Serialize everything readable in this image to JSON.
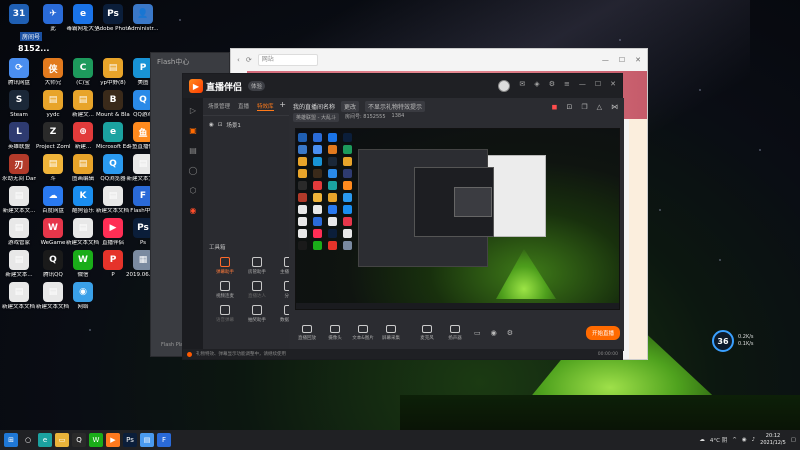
{
  "desktop": {
    "icons": [
      {
        "label": "",
        "glyph": "31",
        "color": "#1f5fb3"
      },
      {
        "label": "此",
        "glyph": "✈",
        "color": "#2a6bd8"
      },
      {
        "label": "毒霸网址大全",
        "glyph": "e",
        "color": "#1a73e8"
      },
      {
        "label": "Adobe Photosh...",
        "glyph": "Ps",
        "color": "#0b1e3a"
      },
      {
        "label": "Administr...",
        "glyph": "👤",
        "color": "#3a78c8"
      },
      {
        "label": "腾讯网盘",
        "glyph": "⟳",
        "color": "#4a8ef0"
      },
      {
        "label": "大师兄",
        "glyph": "侠",
        "color": "#e27a1e"
      },
      {
        "label": "(C)宝",
        "glyph": "C",
        "color": "#1d9a5c"
      },
      {
        "label": "yp中野(8)",
        "glyph": "▤",
        "color": "#e8a42a"
      },
      {
        "label": "美图",
        "glyph": "P",
        "color": "#1893d6"
      },
      {
        "label": "Steam",
        "glyph": "S",
        "color": "#1b2838"
      },
      {
        "label": "yydc",
        "glyph": "▤",
        "color": "#e8a42a"
      },
      {
        "label": "新建文...",
        "glyph": "▤",
        "color": "#e8a42a"
      },
      {
        "label": "Mount & Blade II...",
        "glyph": "B",
        "color": "#3a2a1a"
      },
      {
        "label": "QQ游戏",
        "glyph": "Q",
        "color": "#2a8ae8"
      },
      {
        "label": "英雄联盟",
        "glyph": "L",
        "color": "#2e3b70"
      },
      {
        "label": "Project Zomboid",
        "glyph": "Z",
        "color": "#2a2a2a"
      },
      {
        "label": "新建...",
        "glyph": "⊕",
        "color": "#e23b3b"
      },
      {
        "label": "Microsoft Edge",
        "glyph": "e",
        "color": "#1ba2a0"
      },
      {
        "label": "斗鱼直播伴侣",
        "glyph": "鱼",
        "color": "#ff8a1e"
      },
      {
        "label": "永劫无间 Dance of Fir...",
        "glyph": "刃",
        "color": "#b23a2a"
      },
      {
        "label": "斗",
        "glyph": "▤",
        "color": "#f0b43a"
      },
      {
        "label": "图画编辑",
        "glyph": "▤",
        "color": "#e8a42a"
      },
      {
        "label": "QQ浏览器",
        "glyph": "Q",
        "color": "#2a9af0"
      },
      {
        "label": "新建文本文档",
        "glyph": "▤",
        "color": "#e8e8e8"
      },
      {
        "label": "新建文本文...",
        "glyph": "▤",
        "color": "#e8e8e8"
      },
      {
        "label": "百度网盘",
        "glyph": "☁",
        "color": "#2a7af0"
      },
      {
        "label": "酷狗音乐",
        "glyph": "K",
        "color": "#1a8ef0"
      },
      {
        "label": "新建文本文档 (2)",
        "glyph": "▤",
        "color": "#e8e8e8"
      },
      {
        "label": "Flash中心",
        "glyph": "F",
        "color": "#2a6ad8"
      },
      {
        "label": "游戏管家",
        "glyph": "▤",
        "color": "#e8e8e8"
      },
      {
        "label": "WeGame",
        "glyph": "W",
        "color": "#e6364a"
      },
      {
        "label": "新建文本文档 (3)",
        "glyph": "▤",
        "color": "#e8e8e8"
      },
      {
        "label": "直播伴侣",
        "glyph": "▶",
        "color": "#ff2e55"
      },
      {
        "label": "Ps",
        "glyph": "Ps",
        "color": "#0b1e3a"
      },
      {
        "label": "新建文本...",
        "glyph": "▤",
        "color": "#e8e8e8"
      },
      {
        "label": "腾讯QQ",
        "glyph": "Q",
        "color": "#1a1a1a"
      },
      {
        "label": "微信",
        "glyph": "W",
        "color": "#1aad19"
      },
      {
        "label": "P",
        "glyph": "P",
        "color": "#e5332a"
      },
      {
        "label": "2019.06.11 截图",
        "glyph": "▦",
        "color": "#7a8aa0"
      },
      {
        "label": "新建文本文档 (4)",
        "glyph": "▤",
        "color": "#e8e8e8"
      },
      {
        "label": "新建文本文档 (7)",
        "glyph": "▤",
        "color": "#e8e8e8"
      },
      {
        "label": "网络",
        "glyph": "◉",
        "color": "#3aa0e8"
      }
    ],
    "room_label": "房间号",
    "room_number": "8152...",
    "rates": [
      "0.2K/s",
      "0.1K/s"
    ],
    "widget_value": "36"
  },
  "ghost_window": {
    "title": "Flash中心",
    "footer": "Flash Play..."
  },
  "browser": {
    "address": "网站"
  },
  "live": {
    "app_title": "直播伴侣",
    "badge": "体验",
    "left_tabs": [
      "场景管理",
      "直播",
      "特效库"
    ],
    "active_tab_index": 2,
    "scene_label": "场景1",
    "toolbox_title": "工具箱",
    "tools": [
      {
        "label": "弹幕助手",
        "hot": true
      },
      {
        "label": "房管助手",
        "hot": false
      },
      {
        "label": "主播任务",
        "hot": false
      },
      {
        "label": "视频连麦",
        "hot": false
      },
      {
        "label": "直播达人",
        "hot": false,
        "dim": true
      },
      {
        "label": "分享",
        "hot": false
      },
      {
        "label": "语音弹幕",
        "hot": false,
        "dim": true
      },
      {
        "label": "抽奖助手",
        "hot": false
      },
      {
        "label": "数据统计",
        "hot": false
      }
    ],
    "stream_title": "我的直播间名称",
    "stream_chip": "更改",
    "stream_sub_chip": "不显示礼物特效提示",
    "category": "英雄联盟 - 大乱斗",
    "room_info": "房间号: 8152555",
    "viewers": "1384",
    "bottom_tools": [
      "直播回放",
      "摄像头",
      "文本&图片",
      "屏幕采集",
      "麦克风",
      "扬声器"
    ],
    "go_live": "开始直播",
    "status_text": "礼物特效、弹幕显示功能调整中，请继续使用",
    "status_right": "00:00:00"
  },
  "taskbar": {
    "weather": "4°C 阴",
    "time": "20:12",
    "date": "2021/12/5"
  }
}
